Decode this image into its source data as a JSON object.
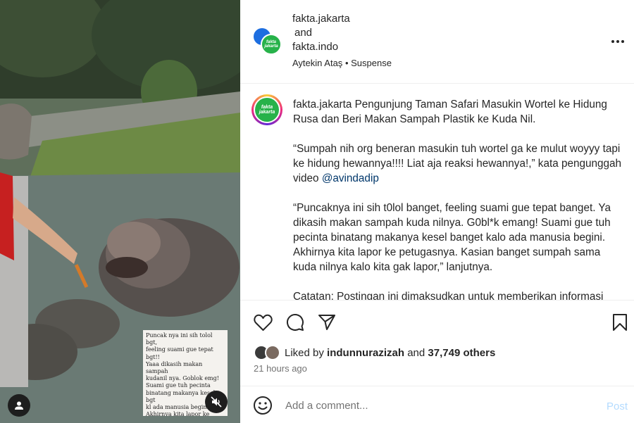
{
  "header": {
    "collab_user_1": "fakta.jakarta",
    "collab_and": "and",
    "collab_user_2": "fakta.indo",
    "audio_artist": "Aytekin Ataş",
    "audio_separator": "•",
    "audio_title": "Suspense",
    "more_icon": "more-horizontal-icon",
    "more_label": "•••"
  },
  "avatar": {
    "logo_text": "fakta\njakarta",
    "brand_color": "#27b24a"
  },
  "media": {
    "overlay_text": "Puncak nya ini sih tolol bgt,\nfeeling suami gue tepat bgt!!\nYaaa dikasih makan sampah\nkudanil nya. Goblok emg!\nSuami gue tuh pecinta\nbinatang makanya kesel bgt\nkl ada manusia begini.\nAkhirnya kita lapor ke\npetugas nya. Kasian bgt\nsumpah kl kita ga lapor\nkudanilnya",
    "user_tag_icon": "user-icon",
    "mute_icon": "speaker-muted-icon"
  },
  "caption": {
    "username": "fakta.jakarta",
    "headline": " Pengunjung Taman Safari Masukin Wortel ke Hidung Rusa dan Beri Makan Sampah Plastik ke Kuda Nil.",
    "para2": "“Sumpah nih org beneran masukin tuh wortel ga ke mulut woyyy tapi ke hidung hewannya!!!! Liat aja reaksi hewannya!,” kata pengunggah video ",
    "mention": "@avindadip",
    "para3": "“Puncaknya ini sih t0lol banget, feeling suami gue tepat banget. Ya dikasih makan sampah kuda nilnya. G0bl*k emang! Suami gue tuh pecinta binatang makanya kesel banget kalo ada manusia begini. Akhirnya kita lapor ke petugasnya. Kasian banget sumpah sama kuda nilnya kalo kita gak lapor,” lanjutnya.",
    "para4": "Catatan: Postingan ini dimaksudkan untuk memberikan informasi"
  },
  "actions": {
    "like_icon": "heart-icon",
    "comment_icon": "comment-icon",
    "share_icon": "send-icon",
    "save_icon": "bookmark-icon"
  },
  "likes": {
    "prefix": "Liked by ",
    "user": "indunnurazizah",
    "middle": " and ",
    "others": "37,749 others",
    "time": "21 hours ago"
  },
  "comment": {
    "emoji_icon": "emoji-icon",
    "placeholder": "Add a comment...",
    "post_label": "Post",
    "post_color": "#b3dbff"
  }
}
